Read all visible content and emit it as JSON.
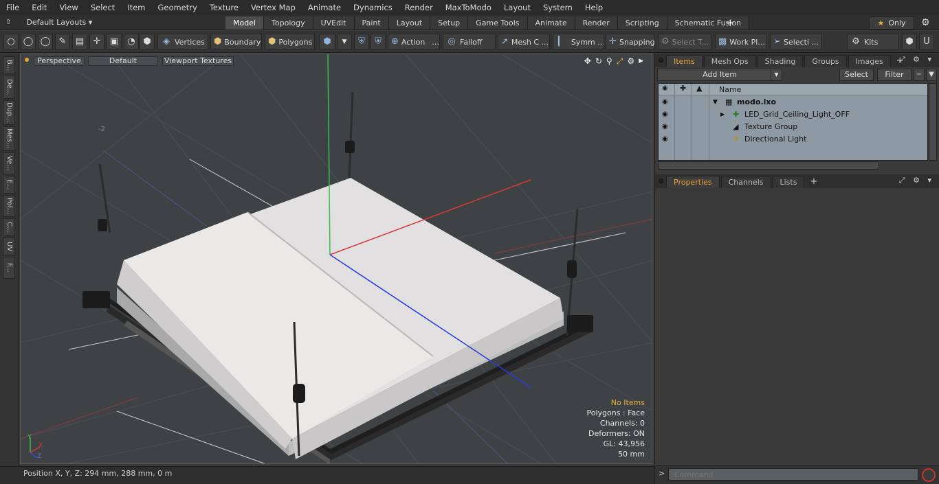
{
  "menu": [
    "File",
    "Edit",
    "View",
    "Select",
    "Item",
    "Geometry",
    "Texture",
    "Vertex Map",
    "Animate",
    "Dynamics",
    "Render",
    "MaxToModo",
    "Layout",
    "System",
    "Help"
  ],
  "layouts": {
    "label": "Default Layouts ▾"
  },
  "tabs": [
    "Model",
    "Topology",
    "UVEdit",
    "Paint",
    "Layout",
    "Setup",
    "Game Tools",
    "Animate",
    "Render",
    "Scripting",
    "Schematic Fusion"
  ],
  "tabs_plus": "+",
  "only_label": "Only",
  "toolbar": {
    "vertices": "Vertices",
    "boundary": "Boundary",
    "polygons": "Polygons",
    "action": "Action",
    "action_more": "...",
    "falloff": "Falloff",
    "mesh": "Mesh C ...",
    "symm": "Symm ...",
    "snapping": "Snapping",
    "select_t": "Select T...",
    "work_pl": "Work Pl...",
    "selecti": "Selecti ...",
    "kits": "Kits"
  },
  "left_strip": [
    "B...",
    "De...",
    "Dup...",
    "Mes...",
    "Ve...",
    "E...",
    "Pol...",
    "C...",
    "UV",
    "F..."
  ],
  "viewport": {
    "view_mode": "Perspective",
    "shading": "Default",
    "textures": "Viewport Textures",
    "grid_label": "-2",
    "info": {
      "no_items": "No Items",
      "polygons": "Polygons : Face",
      "channels": "Channels: 0",
      "deformers": "Deformers: ON",
      "gl": "GL: 43,956",
      "scale": "50 mm"
    },
    "axis": {
      "x": "X",
      "y": "Y",
      "z": "Z"
    }
  },
  "status": {
    "position": "Position X, Y, Z:   294 mm, 288 mm, 0 m"
  },
  "items_panel": {
    "tabs": [
      "Items",
      "Mesh Ops",
      "Shading",
      "Groups",
      "Images"
    ],
    "plus": "+",
    "add_item": "Add Item",
    "select": "Select",
    "filter": "Filter",
    "name_header": "Name",
    "tree": [
      {
        "label": "modo.lxo"
      },
      {
        "label": "LED_Grid_Ceiling_Light_OFF"
      },
      {
        "label": "Texture Group"
      },
      {
        "label": "Directional Light"
      }
    ]
  },
  "props_panel": {
    "tabs": [
      "Properties",
      "Channels",
      "Lists"
    ],
    "plus": "+"
  },
  "command": {
    "placeholder": "Command"
  },
  "colors": {
    "accent": "#e8a33c",
    "viewport_bg": "#3e4245",
    "tree_bg": "#8e9aa3"
  }
}
